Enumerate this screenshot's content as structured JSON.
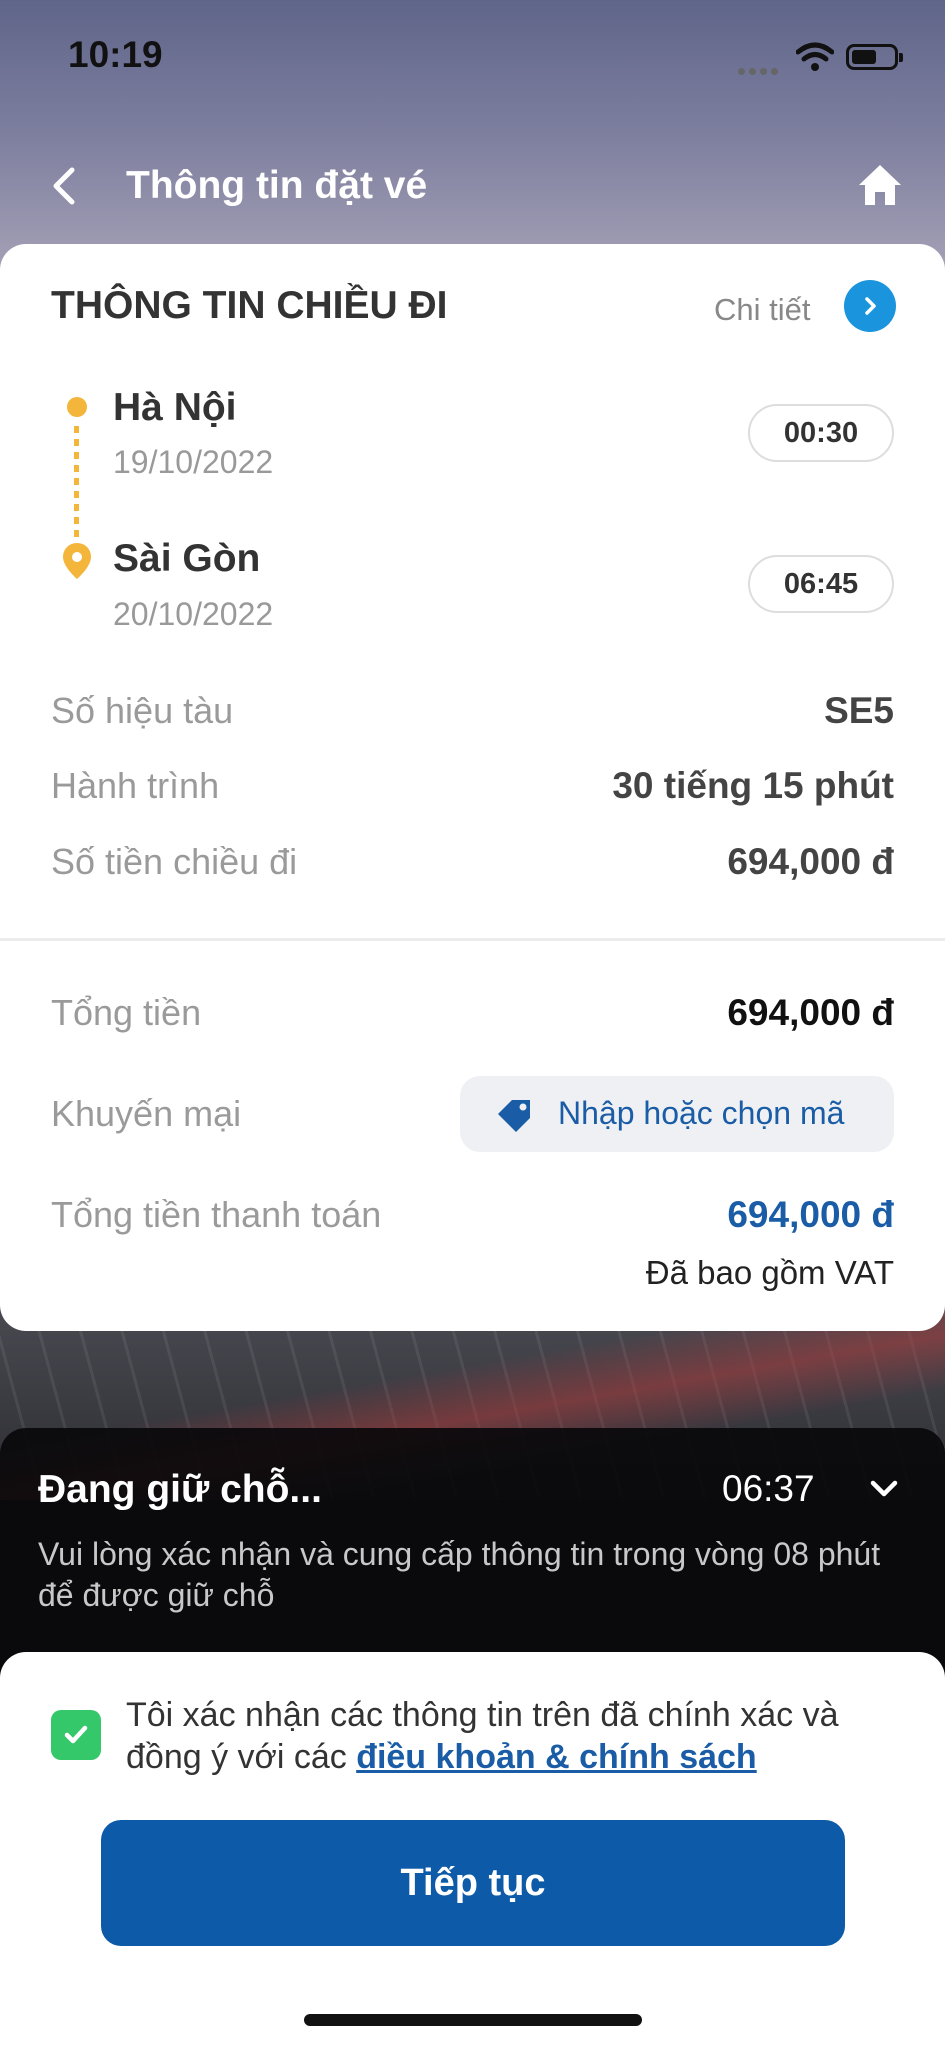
{
  "status_bar": {
    "time": "10:19",
    "icons": [
      "signal-icon",
      "wifi-icon",
      "battery-icon"
    ]
  },
  "nav": {
    "title": "Thông tin đặt vé",
    "icons": [
      "back-arrow-icon",
      "home-icon"
    ]
  },
  "outbound": {
    "section_title": "THÔNG TIN CHIỀU ĐI",
    "detail_label": "Chi tiết",
    "origin": {
      "station": "Hà Nội",
      "date": "19/10/2022",
      "time": "00:30"
    },
    "destination": {
      "station": "Sài Gòn",
      "date": "20/10/2022",
      "time": "06:45"
    },
    "rows": [
      {
        "label": "Số hiệu tàu",
        "value": "SE5"
      },
      {
        "label": "Hành trình",
        "value": "30 tiếng 15 phút"
      },
      {
        "label": "Số tiền chiều đi",
        "value": "694,000 đ"
      }
    ]
  },
  "summary": {
    "total_label": "Tổng tiền",
    "total_value": "694,000 đ",
    "promo_label": "Khuyến mại",
    "promo_button": "Nhập hoặc chọn mã",
    "pay_label": "Tổng tiền thanh toán",
    "pay_value": "694,000 đ",
    "vat_note": "Đã bao gồm VAT"
  },
  "hold": {
    "title": "Đang giữ chỗ...",
    "timer": "06:37",
    "message": "Vui lòng xác nhận và cung cấp thông tin trong vòng 08 phút để được giữ chỗ"
  },
  "confirm": {
    "checked": true,
    "text": "Tôi xác nhận các thông tin trên đã chính xác và đồng ý với các ",
    "link": "điều khoản & chính sách",
    "button": "Tiếp tục"
  },
  "colors": {
    "primary": "#0d5aa8",
    "accent_blue": "#1a95dd",
    "route_yellow": "#f4b53b",
    "check_green": "#34c86a"
  }
}
